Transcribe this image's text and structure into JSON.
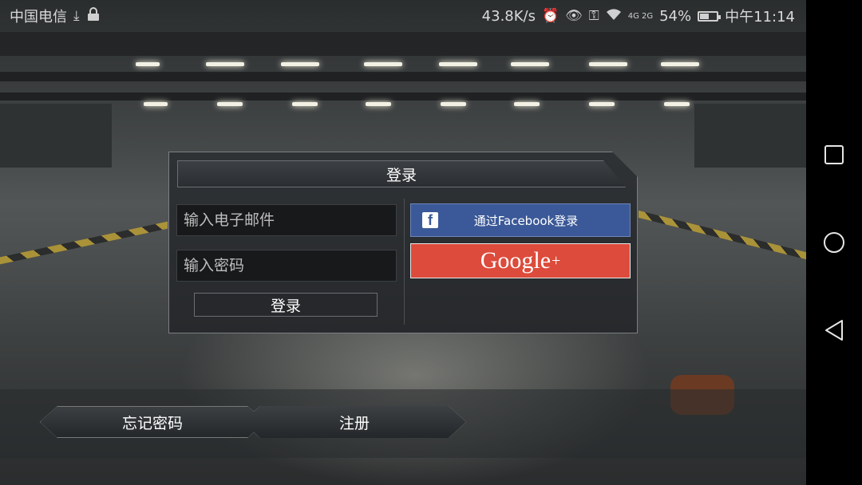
{
  "status_bar": {
    "carrier": "中国电信",
    "net_speed": "43.8K/s",
    "signal_label": "4G 2G",
    "battery": "54%",
    "battery_level": 0.54,
    "time": "中午11:14"
  },
  "dialog": {
    "title": "登录",
    "email_placeholder": "输入电子邮件",
    "password_placeholder": "输入密码",
    "login_button": "登录",
    "facebook_button": "通过Facebook登录",
    "google_button": "Google",
    "google_plus": "+"
  },
  "bottom": {
    "forgot_password": "忘记密码",
    "register": "注册"
  },
  "colors": {
    "facebook": "#3b5998",
    "google": "#dc4b3b"
  },
  "icons": {
    "download": "download-icon",
    "lock": "lock-icon",
    "alarm": "alarm-icon",
    "eye": "eye-icon",
    "key": "key-icon",
    "wifi": "wifi-icon",
    "signal": "signal-icon",
    "battery": "battery-icon",
    "recents": "square-icon",
    "home": "circle-icon",
    "back": "triangle-back-icon"
  }
}
